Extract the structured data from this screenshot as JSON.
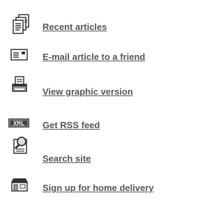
{
  "tools": {
    "items": [
      {
        "id": "recent-articles",
        "label": "Recent articles",
        "icon": "stacked-documents-icon"
      },
      {
        "id": "email-article",
        "label": "E-mail article to a friend",
        "icon": "envelope-icon"
      },
      {
        "id": "graphic-version",
        "label": "View graphic version",
        "icon": "printer-icon"
      },
      {
        "id": "rss-feed",
        "label": "Get RSS feed",
        "icon": "xml-badge-icon"
      },
      {
        "id": "search-site",
        "label": "Search site",
        "icon": "magnifier-document-icon"
      },
      {
        "id": "home-delivery",
        "label": "Sign up for home delivery",
        "icon": "house-icon"
      }
    ],
    "colors": {
      "link": "#555555",
      "icon_stroke": "#333333",
      "icon_fill": "#ffffff",
      "icon_shade": "#999999"
    }
  }
}
